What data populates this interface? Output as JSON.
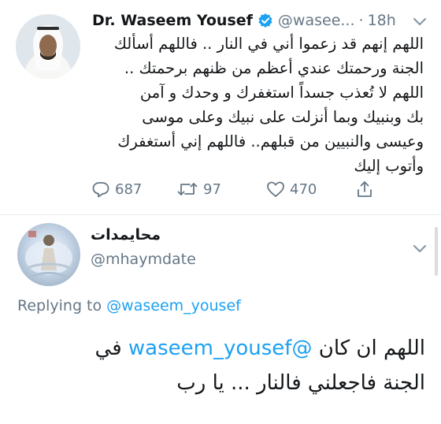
{
  "tweet": {
    "author_name": "Dr. Waseem Yousef",
    "handle": "@wasee...",
    "separator": "·",
    "time": "18h",
    "text_lines": [
      "اللهم إنهم قد زعموا أني في النار .. فاللهم أسألك",
      "الجنة ورحمتك عندي أعظم من ظنهم برحمتك ..",
      "اللهم لا تُعذب جسداً استغفرك و وحدك و آمن",
      "بك وبنبيك وبما أنزلت على نبيك وعلى موسى",
      "وعيسى والنبيين من قبلهم.. فاللهم إني أستغفرك",
      "وأتوب إليك"
    ],
    "actions": {
      "replies": "687",
      "retweets": "97",
      "likes": "470"
    }
  },
  "reply": {
    "author_name": "محايمدات",
    "handle": "@mhaymdate",
    "replying_to_prefix": "Replying to",
    "replying_to_handle": "@waseem_yousef",
    "line1_prefix": "اللهم ان كان",
    "line1_mention": "@waseem_yousef",
    "line1_suffix": "في",
    "line2": "الجنة فاجعلني فالنار ... يا رب"
  },
  "colors": {
    "accent": "#1da1f2",
    "text": "#14171a",
    "muted": "#657786",
    "divider": "#e6ecf0"
  },
  "icons": {
    "verified": "verified-badge-icon",
    "reply": "reply-icon",
    "retweet": "retweet-icon",
    "like": "heart-icon",
    "share": "share-icon",
    "more": "chevron-down-icon"
  }
}
